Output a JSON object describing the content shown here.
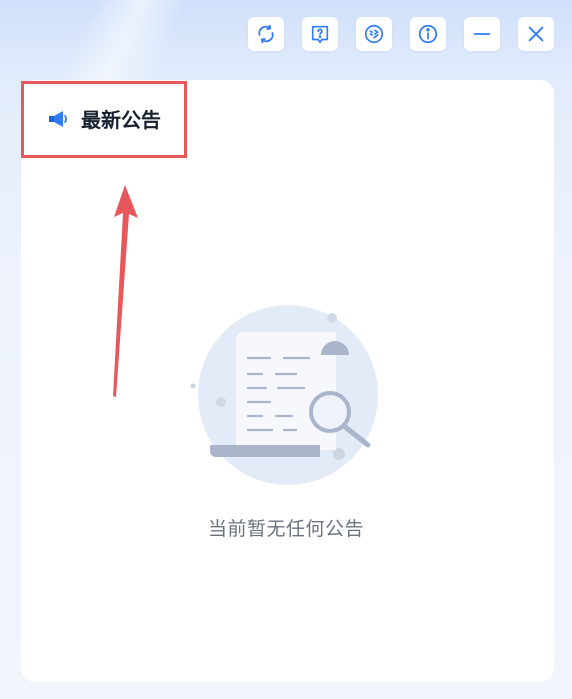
{
  "toolbar": {
    "buttons": [
      {
        "icon": "refresh-icon"
      },
      {
        "icon": "help-book-icon"
      },
      {
        "icon": "diagnose-icon"
      },
      {
        "icon": "info-icon"
      },
      {
        "icon": "minimize-icon"
      },
      {
        "icon": "close-icon"
      }
    ]
  },
  "panel": {
    "title": "最新公告",
    "title_icon": "megaphone-icon"
  },
  "empty_state": {
    "message": "当前暂无任何公告"
  },
  "colors": {
    "accent": "#2f7cf6",
    "highlight": "#e8575a",
    "text_muted": "#6b7380"
  }
}
